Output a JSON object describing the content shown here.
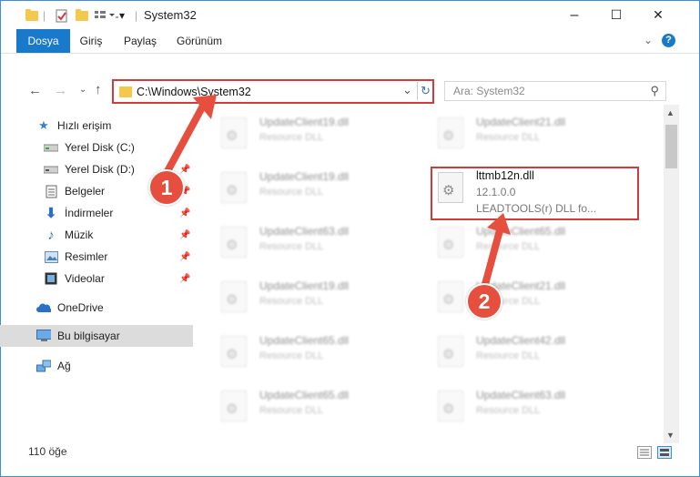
{
  "window": {
    "title": "System32",
    "controls": {
      "minimize": "–",
      "maximize": "☐",
      "close": "✕"
    }
  },
  "ribbon": {
    "tabs": [
      "Dosya",
      "Giriş",
      "Paylaş",
      "Görünüm"
    ],
    "collapse_icon": "chevron-down-icon",
    "help_icon": "?"
  },
  "nav": {
    "address": "C:\\Windows\\System32",
    "search_placeholder": "Ara: System32"
  },
  "sidebar": {
    "items": [
      {
        "label": "Hızlı erişim",
        "icon": "star-icon"
      },
      {
        "label": "Yerel Disk (C:)",
        "icon": "drive-icon"
      },
      {
        "label": "Yerel Disk (D:)",
        "icon": "drive-icon"
      },
      {
        "label": "Belgeler",
        "icon": "documents-icon"
      },
      {
        "label": "İndirmeler",
        "icon": "download-icon"
      },
      {
        "label": "Müzik",
        "icon": "music-icon"
      },
      {
        "label": "Resimler",
        "icon": "pictures-icon"
      },
      {
        "label": "Videolar",
        "icon": "videos-icon"
      },
      {
        "label": "OneDrive",
        "icon": "cloud-icon"
      },
      {
        "label": "Bu bilgisayar",
        "icon": "computer-icon"
      },
      {
        "label": "Ağ",
        "icon": "network-icon"
      }
    ]
  },
  "files": {
    "left": [
      {
        "name": "UpdateClient19.dll",
        "desc": "Resource DLL"
      },
      {
        "name": "UpdateClient19.dll",
        "desc": "Resource DLL"
      },
      {
        "name": "UpdateClient63.dll",
        "desc": "Resource DLL"
      },
      {
        "name": "UpdateClient19.dll",
        "desc": "Resource DLL"
      },
      {
        "name": "UpdateClient65.dll",
        "desc": "Resource DLL"
      },
      {
        "name": "UpdateClient65.dll",
        "desc": "Resource DLL"
      }
    ],
    "right": [
      {
        "name": "UpdateClient21.dll",
        "desc": "Resource DLL"
      },
      {
        "name": "UpdateClient65.dll",
        "desc": "Resource DLL"
      },
      {
        "name": "UpdateClient21.dll",
        "desc": "Resource DLL"
      },
      {
        "name": "UpdateClient42.dll",
        "desc": "Resource DLL"
      },
      {
        "name": "UpdateClient63.dll",
        "desc": "Resource DLL"
      }
    ],
    "highlighted": {
      "name": "lttmb12n.dll",
      "version": "12.1.0.0",
      "desc": "LEADTOOLS(r) DLL fo..."
    }
  },
  "status": {
    "count": "110 öğe"
  },
  "annotations": {
    "step1": "1",
    "step2": "2",
    "color": "#e64e3d"
  }
}
